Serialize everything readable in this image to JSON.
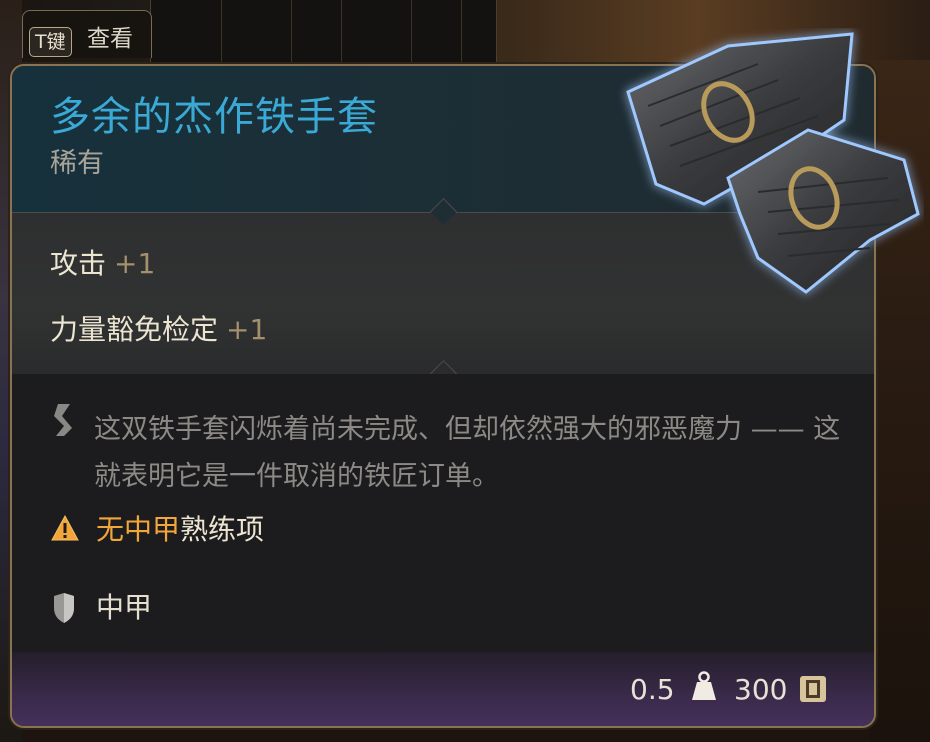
{
  "hotkey": {
    "key": "T键",
    "label": "查看"
  },
  "item": {
    "name": "多余的杰作铁手套",
    "rarity": "稀有",
    "image_icon": "iron-gauntlets-icon"
  },
  "stats": [
    {
      "label": "攻击",
      "bonus": "+1"
    },
    {
      "label": "力量豁免检定",
      "bonus": "+1"
    }
  ],
  "description": "这双铁手套闪烁着尚未完成、但却依然强大的邪恶魔力 —— 这就表明它是一件取消的铁匠订单。",
  "warning": {
    "highlight": "无中甲",
    "rest": "熟练项"
  },
  "armor_type": "中甲",
  "footer": {
    "weight": "0.5",
    "price": "300"
  },
  "colors": {
    "title": "#3aa9d6",
    "warning": "#f2a53a",
    "bonus": "#a48f6e",
    "panel_border": "#8a7352"
  }
}
